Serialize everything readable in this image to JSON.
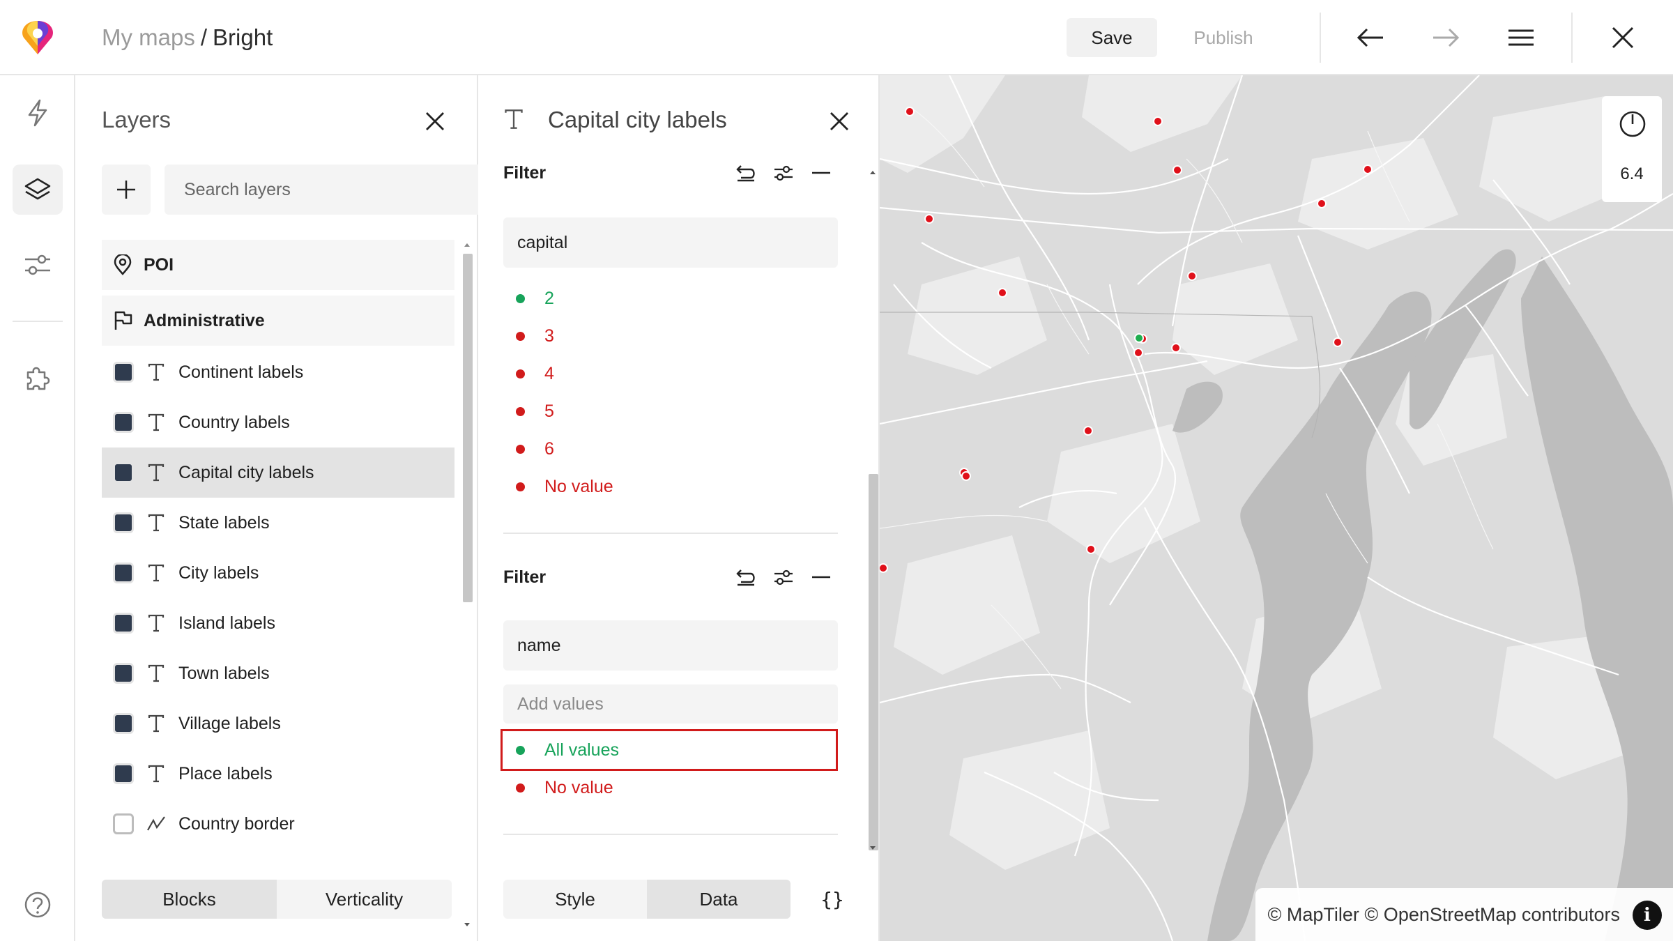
{
  "header": {
    "breadcrumb_parent": "My maps",
    "breadcrumb_separator": "/",
    "breadcrumb_current": "Bright",
    "save_label": "Save",
    "publish_label": "Publish"
  },
  "rail": {
    "icons": [
      "lightning-icon",
      "layers-icon",
      "sliders-icon",
      "puzzle-icon",
      "help-icon"
    ],
    "active": "layers-icon"
  },
  "layers_panel": {
    "title": "Layers",
    "search_placeholder": "Search layers",
    "groups": [
      {
        "label": "POI",
        "icon": "map-pin-icon"
      },
      {
        "label": "Administrative",
        "icon": "flag-icon"
      }
    ],
    "items": [
      {
        "label": "Continent labels",
        "type": "text",
        "visible": true
      },
      {
        "label": "Country labels",
        "type": "text",
        "visible": true
      },
      {
        "label": "Capital city labels",
        "type": "text",
        "visible": true,
        "selected": true
      },
      {
        "label": "State labels",
        "type": "text",
        "visible": true
      },
      {
        "label": "City labels",
        "type": "text",
        "visible": true
      },
      {
        "label": "Island labels",
        "type": "text",
        "visible": true
      },
      {
        "label": "Town labels",
        "type": "text",
        "visible": true
      },
      {
        "label": "Village labels",
        "type": "text",
        "visible": true
      },
      {
        "label": "Place labels",
        "type": "text",
        "visible": true
      },
      {
        "label": "Country border",
        "type": "line",
        "visible": false
      }
    ],
    "tabs": [
      "Blocks",
      "Verticality"
    ],
    "active_tab": "Blocks"
  },
  "editor": {
    "title": "Capital city labels",
    "filters": [
      {
        "label": "Filter",
        "field": "capital",
        "values": [
          {
            "label": "2",
            "state": "on"
          },
          {
            "label": "3",
            "state": "off"
          },
          {
            "label": "4",
            "state": "off"
          },
          {
            "label": "5",
            "state": "off"
          },
          {
            "label": "6",
            "state": "off"
          },
          {
            "label": "No value",
            "state": "off"
          }
        ]
      },
      {
        "label": "Filter",
        "field": "name",
        "add_placeholder": "Add values",
        "values": [
          {
            "label": "All values",
            "state": "on",
            "highlighted": true
          },
          {
            "label": "No value",
            "state": "off"
          }
        ]
      }
    ],
    "tabs": [
      "Style",
      "Data"
    ],
    "active_tab": "Data",
    "json_label": "{}"
  },
  "map": {
    "zoom": "6.4",
    "attribution": "© MapTiler © OpenStreetMap contributors",
    "colors": {
      "land": "#dcdcdc",
      "water": "#bdbdbd",
      "road": "#ffffff",
      "marker_off": "#e0101a",
      "marker_on": "#1fae4f"
    }
  }
}
